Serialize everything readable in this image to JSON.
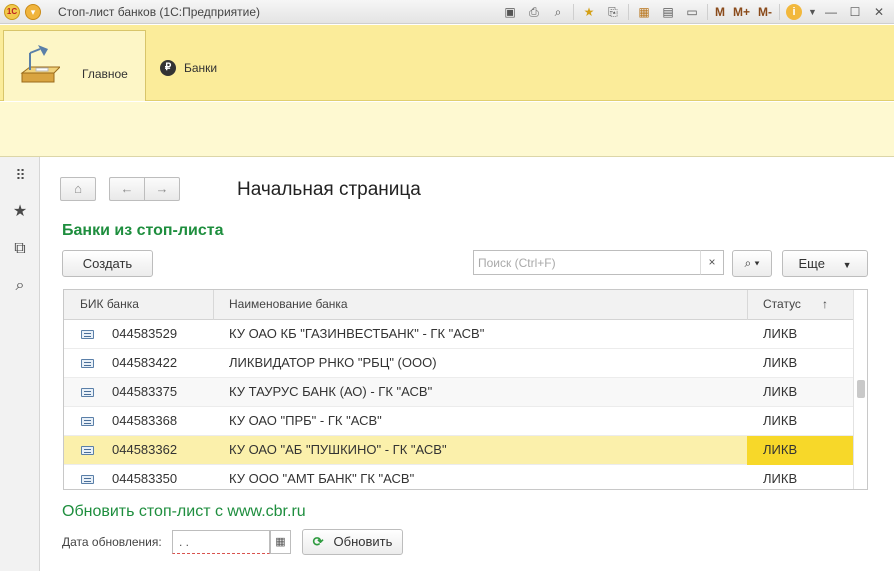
{
  "window": {
    "title": "Стоп-лист банков  (1С:Предприятие)",
    "logo_text": "1С",
    "tool_m": "M",
    "tool_mplus": "M+",
    "tool_mminus": "M-"
  },
  "sections": {
    "home_label": "Главное",
    "banks_label": "Банки",
    "banks_icon_glyph": "₽"
  },
  "navigation": {
    "page_title": "Начальная страница"
  },
  "form": {
    "title": "Банки из стоп-листа",
    "create_button": "Создать",
    "search_placeholder": "Поиск (Ctrl+F)",
    "more_button": "Еще",
    "table": {
      "columns": [
        "БИК банка",
        "Наименование банка",
        "Статус"
      ],
      "sort_indicator": "↑",
      "rows": [
        {
          "bik": "044583529",
          "name": "КУ ОАО КБ \"ГАЗИНВЕСТБАНК\" - ГК \"АСВ\"",
          "status": "ЛИКВ"
        },
        {
          "bik": "044583422",
          "name": "ЛИКВИДАТОР РНКО \"РБЦ\" (ООО)",
          "status": "ЛИКВ"
        },
        {
          "bik": "044583375",
          "name": "КУ ТАУРУС БАНК (АО) - ГК \"АСВ\"",
          "status": "ЛИКВ"
        },
        {
          "bik": "044583368",
          "name": "КУ ОАО \"ПРБ\" - ГК \"АСВ\"",
          "status": "ЛИКВ"
        },
        {
          "bik": "044583362",
          "name": "КУ ОАО \"АБ \"ПУШКИНО\" - ГК \"АСВ\"",
          "status": "ЛИКВ",
          "selected": true
        },
        {
          "bik": "044583350",
          "name": "КУ ООО \"АМТ БАНК\" ГК \"АСВ\"",
          "status": "ЛИКВ"
        }
      ]
    },
    "update_link": "Обновить стоп-лист с www.cbr.ru",
    "date_label": "Дата обновления:",
    "date_value": " .  .",
    "update_button": "Обновить"
  },
  "colors": {
    "accent_green": "#1e8e3e",
    "section_panel": "#fbec9a",
    "selected_row": "#fbf0ab",
    "selected_status": "#f7d829"
  }
}
